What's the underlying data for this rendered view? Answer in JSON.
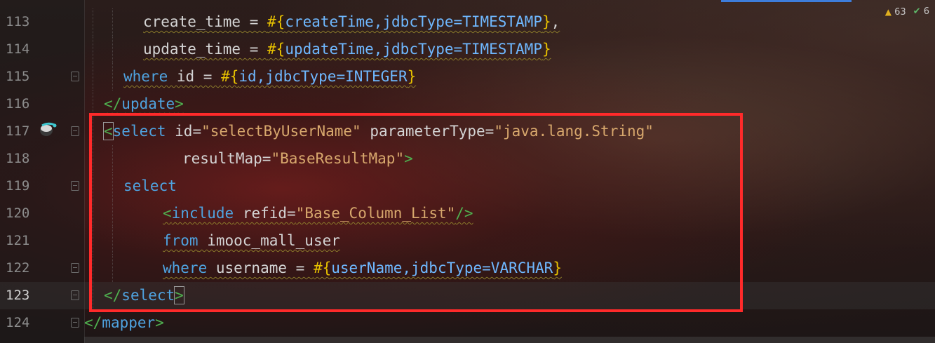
{
  "inspection": {
    "warnings": "63",
    "typos": "6",
    "accent": "#3d7ddb"
  },
  "lines": [
    {
      "number": "113",
      "segments": [
        {
          "text": "create_time = ",
          "cls": "plain"
        },
        {
          "text": "#{",
          "cls": "brace"
        },
        {
          "text": "createTime,jdbcType=TIMESTAMP",
          "cls": "ph"
        },
        {
          "text": "}",
          "cls": "brace"
        },
        {
          "text": ",",
          "cls": "plain"
        }
      ]
    },
    {
      "number": "114",
      "segments": [
        {
          "text": "update_time = ",
          "cls": "plain"
        },
        {
          "text": "#{",
          "cls": "brace"
        },
        {
          "text": "updateTime,jdbcType=TIMESTAMP",
          "cls": "ph"
        },
        {
          "text": "}",
          "cls": "brace"
        }
      ]
    },
    {
      "number": "115",
      "segments": [
        {
          "text": "where",
          "cls": "kw"
        },
        {
          "text": " id = ",
          "cls": "plain"
        },
        {
          "text": "#{",
          "cls": "brace"
        },
        {
          "text": "id,jdbcType=INTEGER",
          "cls": "ph"
        },
        {
          "text": "}",
          "cls": "brace"
        }
      ]
    },
    {
      "number": "116",
      "segments": [
        {
          "text": "</",
          "cls": "bracket-tag"
        },
        {
          "text": "update",
          "cls": "tag"
        },
        {
          "text": ">",
          "cls": "bracket-tag"
        }
      ]
    },
    {
      "number": "117",
      "segments": [
        {
          "text": "<",
          "cls": "bracket-tag"
        },
        {
          "text": "select",
          "cls": "tag"
        },
        {
          "text": " id=",
          "cls": "attr"
        },
        {
          "text": "\"selectByUserName\"",
          "cls": "str"
        },
        {
          "text": " parameterType=",
          "cls": "attr"
        },
        {
          "text": "\"java.lang.String\"",
          "cls": "str"
        }
      ]
    },
    {
      "number": "118",
      "segments": [
        {
          "text": "resultMap=",
          "cls": "attr"
        },
        {
          "text": "\"BaseResultMap\"",
          "cls": "str"
        },
        {
          "text": ">",
          "cls": "bracket-tag"
        }
      ]
    },
    {
      "number": "119",
      "segments": [
        {
          "text": "select",
          "cls": "kw"
        }
      ]
    },
    {
      "number": "120",
      "segments": [
        {
          "text": "<",
          "cls": "bracket-tag"
        },
        {
          "text": "include",
          "cls": "tag"
        },
        {
          "text": " refid=",
          "cls": "attr"
        },
        {
          "text": "\"Base_Column_List\"",
          "cls": "str"
        },
        {
          "text": "/>",
          "cls": "bracket-tag"
        }
      ]
    },
    {
      "number": "121",
      "segments": [
        {
          "text": "from",
          "cls": "kw"
        },
        {
          "text": " imooc_mall_user",
          "cls": "plain"
        }
      ]
    },
    {
      "number": "122",
      "segments": [
        {
          "text": "where",
          "cls": "kw"
        },
        {
          "text": " username = ",
          "cls": "plain"
        },
        {
          "text": "#{",
          "cls": "brace"
        },
        {
          "text": "userName,jdbcType=VARCHAR",
          "cls": "ph"
        },
        {
          "text": "}",
          "cls": "brace"
        }
      ]
    },
    {
      "number": "123",
      "segments": [
        {
          "text": "</",
          "cls": "bracket-tag"
        },
        {
          "text": "select",
          "cls": "tag"
        },
        {
          "text": ">",
          "cls": "bracket-tag"
        }
      ]
    },
    {
      "number": "124",
      "segments": [
        {
          "text": "</",
          "cls": "bracket-tag"
        },
        {
          "text": "mapper",
          "cls": "tag"
        },
        {
          "text": ">",
          "cls": "bracket-tag"
        }
      ]
    }
  ],
  "colors": {
    "highlight_border": "#ff2a2a",
    "tag": "#4fa3e0",
    "string": "#d8a86d",
    "placeholder_brace": "#e6c000"
  }
}
